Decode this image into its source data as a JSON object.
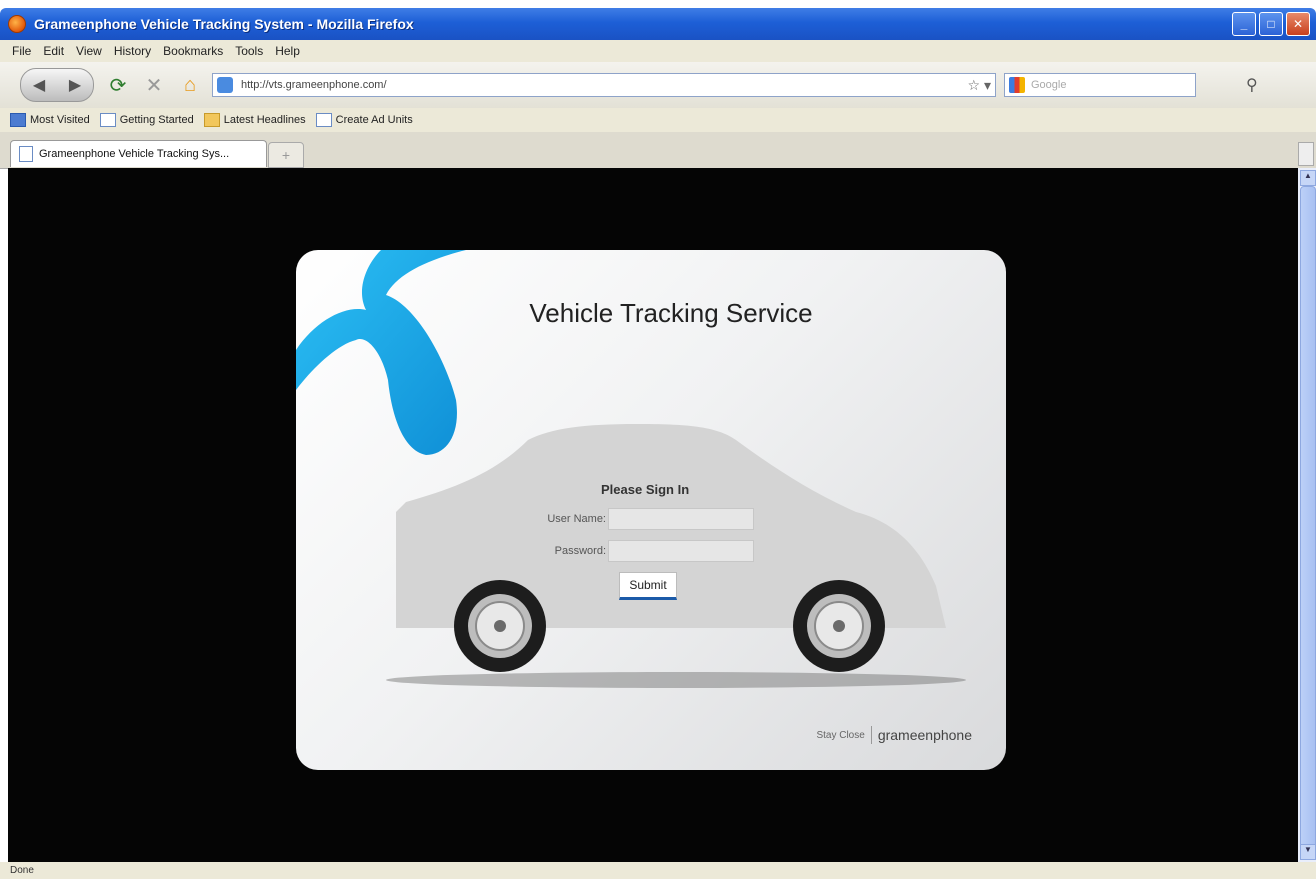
{
  "window": {
    "title": "Grameenphone Vehicle Tracking System - Mozilla Firefox"
  },
  "menu": [
    "File",
    "Edit",
    "View",
    "History",
    "Bookmarks",
    "Tools",
    "Help"
  ],
  "navbar": {
    "url": "http://vts.grameenphone.com/",
    "search_placeholder": "Google"
  },
  "bookmarks": [
    {
      "label": "Most Visited",
      "icon": "most-visited-icon"
    },
    {
      "label": "Getting Started",
      "icon": "page-icon"
    },
    {
      "label": "Latest Headlines",
      "icon": "rss-folder-icon"
    },
    {
      "label": "Create Ad Units",
      "icon": "page-icon"
    }
  ],
  "tab": {
    "label": "Grameenphone Vehicle Tracking Sys..."
  },
  "login": {
    "heading": "Vehicle Tracking Service",
    "signin_title": "Please Sign In",
    "username_label": "User Name:",
    "password_label": "Password:",
    "username_value": "",
    "password_value": "",
    "submit_label": "Submit",
    "tagline": "Stay Close",
    "brand": "grameenphone"
  },
  "status": {
    "text": "Done"
  },
  "colors": {
    "logo_blue": "#16a4e6",
    "titlebar_blue": "#1d5fd6",
    "submit_underline": "#1b5aa8"
  }
}
